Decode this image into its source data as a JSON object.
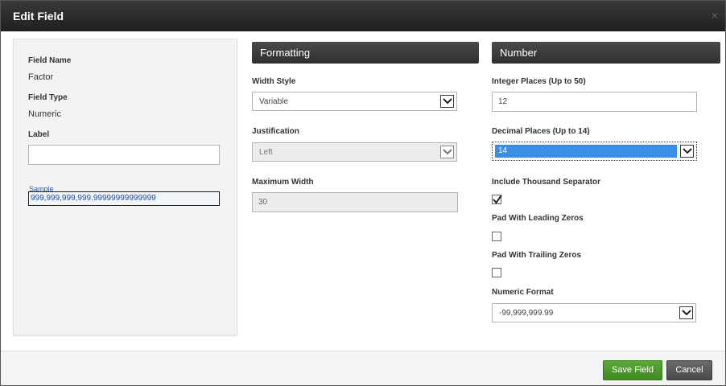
{
  "dialog": {
    "title": "Edit Field",
    "close_glyph": "×"
  },
  "left": {
    "field_name_label": "Field Name",
    "field_name_value": "Factor",
    "field_type_label": "Field Type",
    "field_type_value": "Numeric",
    "label_label": "Label",
    "label_value": "",
    "sample_label": "Sample",
    "sample_value": "999,999,999,999.99999999999999"
  },
  "formatting": {
    "header": "Formatting",
    "width_style_label": "Width Style",
    "width_style_value": "Variable",
    "justification_label": "Justification",
    "justification_value": "Left",
    "max_width_label": "Maximum Width",
    "max_width_value": "30"
  },
  "number": {
    "header": "Number",
    "integer_places_label": "Integer Places (Up to 50)",
    "integer_places_value": "12",
    "decimal_places_label": "Decimal Places (Up to 14)",
    "decimal_places_value": "14",
    "thousand_sep_label": "Include Thousand Separator",
    "thousand_sep_checked": true,
    "leading_zeros_label": "Pad With Leading Zeros",
    "leading_zeros_checked": false,
    "trailing_zeros_label": "Pad With Trailing Zeros",
    "trailing_zeros_checked": false,
    "numeric_format_label": "Numeric Format",
    "numeric_format_value": "-99,999,999.99"
  },
  "footer": {
    "save_label": "Save Field",
    "cancel_label": "Cancel"
  },
  "colors": {
    "save_button": "#4a9a2e",
    "cancel_button": "#555555",
    "header_bg": "#2f2f2f",
    "select_highlight": "#3a8ee6"
  },
  "icons": {
    "dropdown": "chevron-down-icon",
    "check": "check-icon",
    "close": "close-icon"
  }
}
